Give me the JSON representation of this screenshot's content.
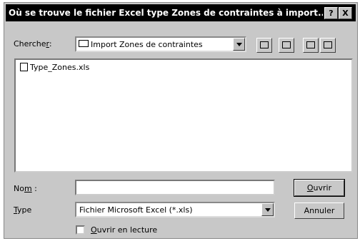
{
  "window": {
    "title": "Où se trouve le fichier Excel type Zones de contraintes  à import...",
    "help_label": "?",
    "close_label": "X"
  },
  "lookin": {
    "label_pre": "Cherche",
    "label_u": "r",
    "label_post": ":",
    "folder": "Import Zones de contraintes"
  },
  "toolbar": {
    "icons": [
      "up-folder-icon",
      "new-folder-icon",
      "list-view-icon",
      "details-view-icon"
    ]
  },
  "files": [
    {
      "name": "Type_Zones.xls",
      "icon": "excel-file-icon"
    }
  ],
  "name_field": {
    "label_pre": "No",
    "label_u": "m",
    "label_post": " :",
    "value": ""
  },
  "type_field": {
    "label_u": "T",
    "label_post": "ype",
    "value": "Fichier Microsoft Excel (*.xls)"
  },
  "buttons": {
    "open_u": "O",
    "open_rest": "uvrir",
    "cancel": "Annuler"
  },
  "readonly": {
    "label_u": "O",
    "label_post": "uvrir en lecture",
    "checked": false
  }
}
